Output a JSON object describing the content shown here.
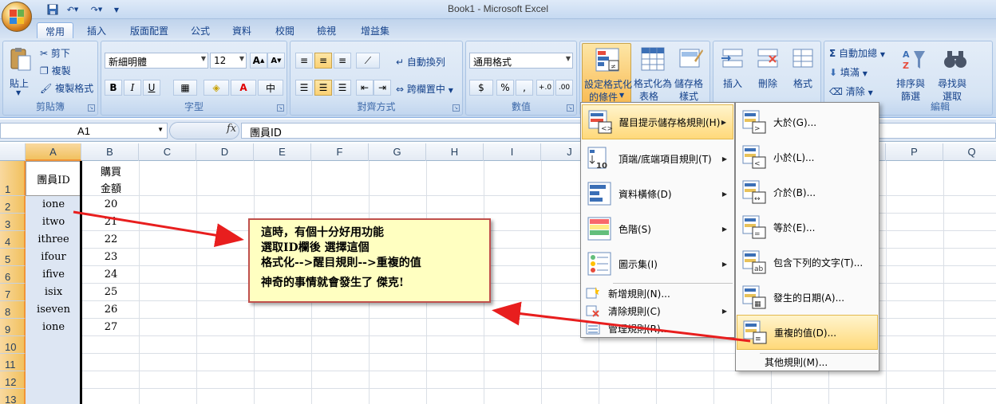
{
  "window": {
    "title": "Book1 - Microsoft Excel"
  },
  "qat": {
    "save": "save-icon",
    "undo": "undo-icon",
    "redo": "redo-icon",
    "customize": "▼"
  },
  "tabs": [
    "常用",
    "插入",
    "版面配置",
    "公式",
    "資料",
    "校閱",
    "檢視",
    "增益集"
  ],
  "active_tab": "常用",
  "ribbon": {
    "clipboard": {
      "paste": "貼上",
      "cut": "剪下",
      "copy": "複製",
      "format_painter": "複製格式",
      "label": "剪貼簿"
    },
    "font": {
      "name": "新細明體",
      "size": "12",
      "bold": "B",
      "italic": "I",
      "underline": "U",
      "grow": "A",
      "shrink": "A",
      "label": "字型"
    },
    "alignment": {
      "wrap": "自動換列",
      "merge": "跨欄置中",
      "label": "對齊方式"
    },
    "number": {
      "format": "通用格式",
      "currency": "$",
      "percent": "%",
      "comma": ",",
      "inc_dec": "+.0",
      "dec_dec": ".00",
      "label": "數值"
    },
    "styles": {
      "conditional_line1": "設定格式化",
      "conditional_line2": "的條件",
      "table_line1": "格式化為",
      "table_line2": "表格",
      "cell_line1": "儲存格",
      "cell_line2": "樣式"
    },
    "cells": {
      "insert": "插入",
      "delete": "刪除",
      "format": "格式"
    },
    "editing": {
      "autosum": "自動加總",
      "fill": "填滿",
      "clear": "清除",
      "sort_line1": "排序與",
      "sort_line2": "篩選",
      "find_line1": "尋找與",
      "find_line2": "選取",
      "label": "編輯"
    }
  },
  "formula_bar": {
    "name_box": "A1",
    "fx": "fx",
    "content": "團員ID"
  },
  "columns": [
    "A",
    "B",
    "C",
    "D",
    "E",
    "F",
    "G",
    "H",
    "I",
    "J",
    "K",
    "L",
    "M",
    "N",
    "O",
    "P",
    "Q"
  ],
  "rows": [
    "1",
    "2",
    "3",
    "4",
    "5",
    "6",
    "7",
    "8",
    "9",
    "10",
    "11",
    "12",
    "13"
  ],
  "sheet": {
    "header_a": "團員ID",
    "header_b_line1": "購買",
    "header_b_line2": "金額",
    "data": [
      [
        "ione",
        "20"
      ],
      [
        "itwo",
        "21"
      ],
      [
        "ithree",
        "22"
      ],
      [
        "ifour",
        "23"
      ],
      [
        "ifive",
        "24"
      ],
      [
        "isix",
        "25"
      ],
      [
        "iseven",
        "26"
      ],
      [
        "ione",
        "27"
      ]
    ]
  },
  "callout": {
    "line1": "這時，有個十分好用功能",
    "line2": "選取ID欄後 選擇這個",
    "line3": "格式化-->醒目規則-->重複的值",
    "line4": "神奇的事情就會發生了 傑克!"
  },
  "cf_menu": {
    "items": [
      {
        "label": "醒目提示儲存格規則(H)",
        "icon": "highlight-rules-icon"
      },
      {
        "label": "頂端/底端項目規則(T)",
        "icon": "top-bottom-icon"
      },
      {
        "label": "資料橫條(D)",
        "icon": "data-bars-icon"
      },
      {
        "label": "色階(S)",
        "icon": "color-scales-icon"
      },
      {
        "label": "圖示集(I)",
        "icon": "icon-sets-icon"
      }
    ],
    "small_items": [
      {
        "label": "新增規則(N)..."
      },
      {
        "label": "清除規則(C)"
      },
      {
        "label": "管理規則(R)..."
      }
    ]
  },
  "sub_menu": {
    "items": [
      {
        "label": "大於(G)..."
      },
      {
        "label": "小於(L)..."
      },
      {
        "label": "介於(B)..."
      },
      {
        "label": "等於(E)..."
      },
      {
        "label": "包含下列的文字(T)..."
      },
      {
        "label": "發生的日期(A)..."
      },
      {
        "label": "重複的值(D)..."
      }
    ],
    "more": "其他規則(M)..."
  },
  "colors": {
    "highlight": "#ffd97a",
    "arrow": "#e81e1e",
    "callout_bg": "#ffffc1"
  }
}
